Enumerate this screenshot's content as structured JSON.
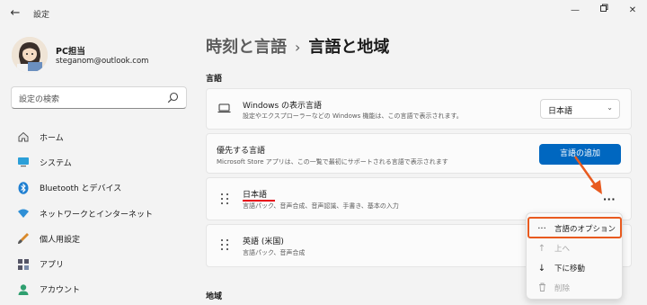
{
  "window": {
    "title": "設定",
    "controls": [
      "minimize-icon",
      "maximize-icon",
      "close-icon"
    ]
  },
  "profile": {
    "name": "PC担当",
    "email": "steganom@outlook.com"
  },
  "search": {
    "placeholder": "設定の検索"
  },
  "sidebar": {
    "items": [
      {
        "label": "ホーム",
        "icon": "home-icon"
      },
      {
        "label": "システム",
        "icon": "system-icon"
      },
      {
        "label": "Bluetooth とデバイス",
        "icon": "bluetooth-icon"
      },
      {
        "label": "ネットワークとインターネット",
        "icon": "network-icon"
      },
      {
        "label": "個人用設定",
        "icon": "brush-icon"
      },
      {
        "label": "アプリ",
        "icon": "apps-icon"
      },
      {
        "label": "アカウント",
        "icon": "account-icon"
      }
    ]
  },
  "breadcrumb": {
    "parent": "時刻と言語",
    "separator": "›",
    "current": "言語と地域"
  },
  "sections": {
    "language": "言語",
    "region": "地域"
  },
  "display_language": {
    "title": "Windows の表示言語",
    "subtitle": "設定やエクスプローラーなどの Windows 機能は、この言語で表示されます。",
    "value": "日本語"
  },
  "preferred_languages": {
    "title": "優先する言語",
    "subtitle": "Microsoft Store アプリは、この一覧で最初にサポートされる言語で表示されます",
    "add_button": "言語の追加"
  },
  "languages": [
    {
      "name": "日本語",
      "features": "言語パック、音声合成、音声認識、手書き、基本の入力"
    },
    {
      "name": "英語 (米国)",
      "features": "言語パック、音声合成"
    }
  ],
  "context_menu": {
    "items": [
      {
        "label": "言語のオプション",
        "icon": "more-icon",
        "enabled": true
      },
      {
        "label": "上へ",
        "icon": "arrow-up-icon",
        "enabled": false
      },
      {
        "label": "下に移動",
        "icon": "arrow-down-icon",
        "enabled": true
      },
      {
        "label": "削除",
        "icon": "trash-icon",
        "enabled": false
      }
    ]
  },
  "colors": {
    "accent": "#0067c0",
    "annotation": "#e85a1f",
    "underline": "#e60012"
  }
}
